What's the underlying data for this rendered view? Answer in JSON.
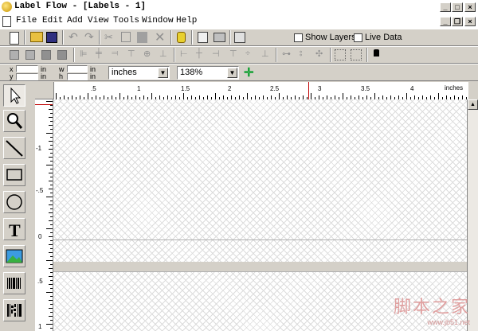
{
  "window": {
    "title": "Label Flow - [Labels - 1]",
    "minimize": "_",
    "maximize": "□",
    "close": "×",
    "doc_min": "_",
    "doc_restore": "❐",
    "doc_close": "×"
  },
  "menu": [
    "File",
    "Edit",
    "Add",
    "View",
    "Tools",
    "Window",
    "Help"
  ],
  "toolbar": {
    "show_layers_label": "Show Layers",
    "live_data_label": "Live Data"
  },
  "props": {
    "x_label": "x",
    "y_label": "y",
    "w_label": "w",
    "h_label": "h",
    "unit_in": "in",
    "unit_select": "inches",
    "zoom_select": "138%"
  },
  "ruler": {
    "h_labels": [
      ".5",
      "1",
      "1.5",
      "2",
      "2.5",
      "3",
      "3.5",
      "4",
      "inches"
    ],
    "v_labels": [
      "-1",
      "-.5",
      "0",
      ".5",
      "1"
    ]
  },
  "watermark": {
    "text": "脚本之家",
    "url": "www.jb51.net"
  },
  "colors": {
    "chrome": "#d4d0c8",
    "accent_red": "#c00000"
  }
}
